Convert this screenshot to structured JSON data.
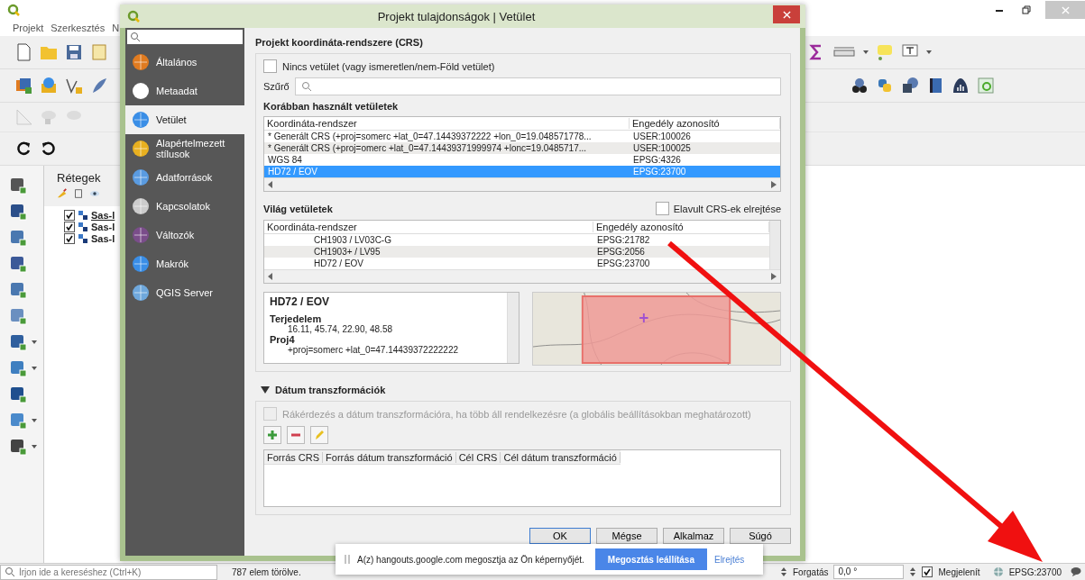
{
  "app": {
    "menu": [
      "Projekt",
      "Szerkesztés",
      "N"
    ],
    "layers_panel": {
      "title": "Rétegek",
      "layers": [
        {
          "name": "Sas-l",
          "checked": true,
          "selected": true
        },
        {
          "name": "Sas-l",
          "checked": true,
          "selected": false
        },
        {
          "name": "Sas-l",
          "checked": true,
          "selected": false
        }
      ]
    },
    "status_bar": {
      "search_placeholder": "Írjon ide a kereséshez (Ctrl+K)",
      "message": "787 elem törölve.",
      "rotation_label": "Forgatás",
      "rotation_value": "0,0 °",
      "render": {
        "label": "Megjelenít",
        "checked": true
      },
      "crs": "EPSG:23700"
    }
  },
  "dialog": {
    "title": "Projekt tulajdonságok | Vetület",
    "sidebar": {
      "items": [
        {
          "label": "Általános",
          "selected": false
        },
        {
          "label": "Metaadat",
          "selected": false
        },
        {
          "label": "Vetület",
          "selected": true
        },
        {
          "label": "Alapértelmezett stílusok",
          "selected": false
        },
        {
          "label": "Adatforrások",
          "selected": false
        },
        {
          "label": "Kapcsolatok",
          "selected": false
        },
        {
          "label": "Változók",
          "selected": false
        },
        {
          "label": "Makrók",
          "selected": false
        },
        {
          "label": "QGIS Server",
          "selected": false
        }
      ]
    },
    "section_title": "Projekt koordináta-rendszere (CRS)",
    "no_projection": {
      "label": "Nincs vetület (vagy ismeretlen/nem-Föld vetület)",
      "checked": false
    },
    "filter": {
      "label": "Szűrő"
    },
    "recent": {
      "title": "Korábban használt vetületek",
      "columns": [
        "Koordináta-rendszer",
        "Engedély azonosító"
      ],
      "rows": [
        {
          "cells": [
            "* Generált CRS (+proj=somerc +lat_0=47.14439372222 +lon_0=19.048571778...",
            "USER:100026"
          ],
          "selected": false
        },
        {
          "cells": [
            "* Generált CRS (+proj=omerc +lat_0=47.14439371999974 +lonc=19.0485717...",
            "USER:100025"
          ],
          "selected": false
        },
        {
          "cells": [
            "WGS 84",
            "EPSG:4326"
          ],
          "selected": false
        },
        {
          "cells": [
            "HD72 / EOV",
            "EPSG:23700"
          ],
          "selected": true
        }
      ]
    },
    "world": {
      "title": "Világ vetületek",
      "hide_deprecated": {
        "label": "Elavult CRS-ek elrejtése",
        "checked": false
      },
      "columns": [
        "Koordináta-rendszer",
        "Engedély azonosító"
      ],
      "rows": [
        {
          "cells": [
            "CH1903 / LV03C-G",
            "EPSG:21782"
          ]
        },
        {
          "cells": [
            "CH1903+ / LV95",
            "EPSG:2056"
          ]
        },
        {
          "cells": [
            "HD72 / EOV",
            "EPSG:23700"
          ]
        }
      ]
    },
    "details": {
      "name": "HD72 / EOV",
      "sections": [
        {
          "heading": "Terjedelem",
          "lines": [
            "16.11, 45.74, 22.90, 48.58"
          ]
        },
        {
          "heading": "Proj4",
          "lines": [
            "+proj=somerc +lat_0=47.14439372222222"
          ]
        }
      ]
    },
    "datum": {
      "title": "Dátum transzformációk",
      "expanded": true,
      "ask": {
        "label": "Rákérdezés a dátum transzformációra, ha több áll rendelkezésre (a globális beállításokban meghatározott)",
        "checked": false,
        "disabled": true
      },
      "columns": [
        "Forrás CRS",
        "Forrás dátum transzformáció",
        "Cél CRS",
        "Cél dátum transzformáció"
      ]
    },
    "buttons": [
      "OK",
      "Mégse",
      "Alkalmaz",
      "Súgó"
    ]
  },
  "notification": {
    "text": "A(z) hangouts.google.com megosztja az Ön képernyőjét.",
    "stop": "Megosztás leállítása",
    "hide": "Elrejtés"
  }
}
